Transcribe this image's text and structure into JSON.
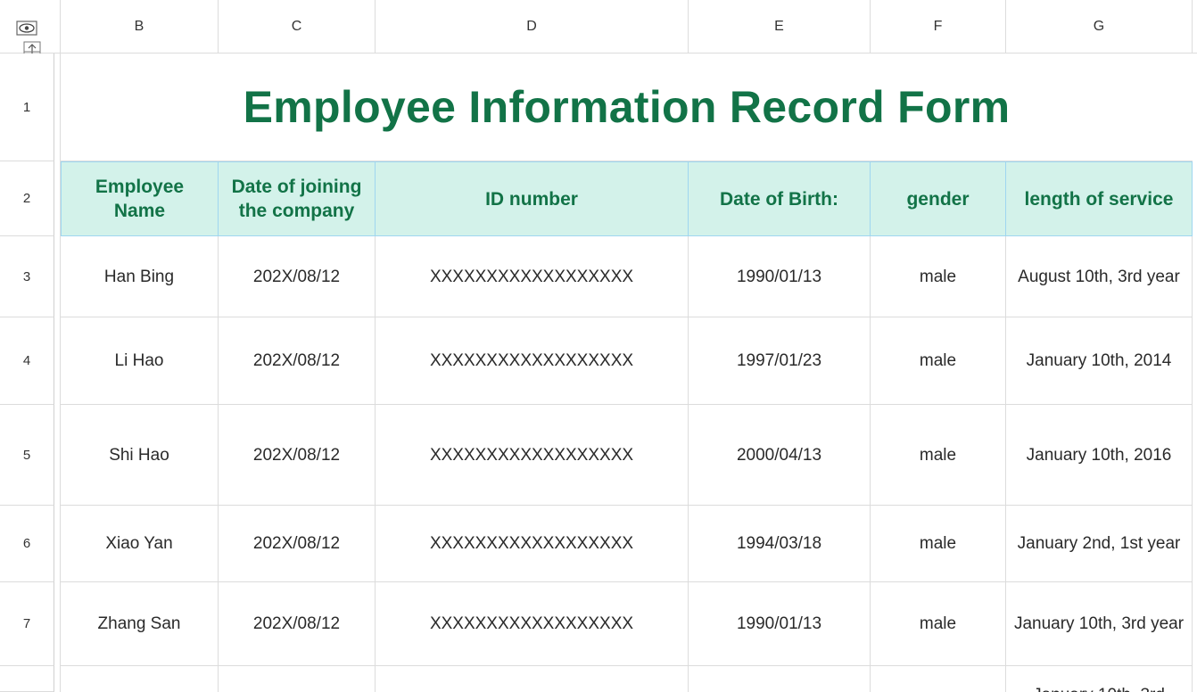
{
  "sheet": {
    "columns": [
      "B",
      "C",
      "D",
      "E",
      "F",
      "G"
    ],
    "rows": [
      "1",
      "2",
      "3",
      "4",
      "5",
      "6",
      "7"
    ],
    "title": "Employee Information Record Form",
    "headers": [
      "Employee Name",
      "Date of joining the company",
      "ID number",
      "Date of Birth:",
      "gender",
      "length of service"
    ],
    "records": [
      [
        "Han Bing",
        "202X/08/12",
        "XXXXXXXXXXXXXXXXXX",
        "1990/01/13",
        "male",
        "August 10th, 3rd year"
      ],
      [
        "Li Hao",
        "202X/08/12",
        "XXXXXXXXXXXXXXXXXX",
        "1997/01/23",
        "male",
        "January 10th, 2014"
      ],
      [
        "Shi Hao",
        "202X/08/12",
        "XXXXXXXXXXXXXXXXXX",
        "2000/04/13",
        "male",
        "January 10th, 2016"
      ],
      [
        "Xiao Yan",
        "202X/08/12",
        "XXXXXXXXXXXXXXXXXX",
        "1994/03/18",
        "male",
        "January 2nd, 1st year"
      ],
      [
        "Zhang San",
        "202X/08/12",
        "XXXXXXXXXXXXXXXXXX",
        "1990/01/13",
        "male",
        "January 10th, 3rd year"
      ]
    ],
    "partial_row_text": "January 10th, 3rd"
  },
  "icons": {
    "corner_top": "eye-icon",
    "corner_bottom": "freeze-panes-icon"
  },
  "colors": {
    "title": "#127347",
    "header_fill": "#d3f2ea",
    "header_border": "#9fd6f0",
    "gridline": "#dcdcdc"
  }
}
